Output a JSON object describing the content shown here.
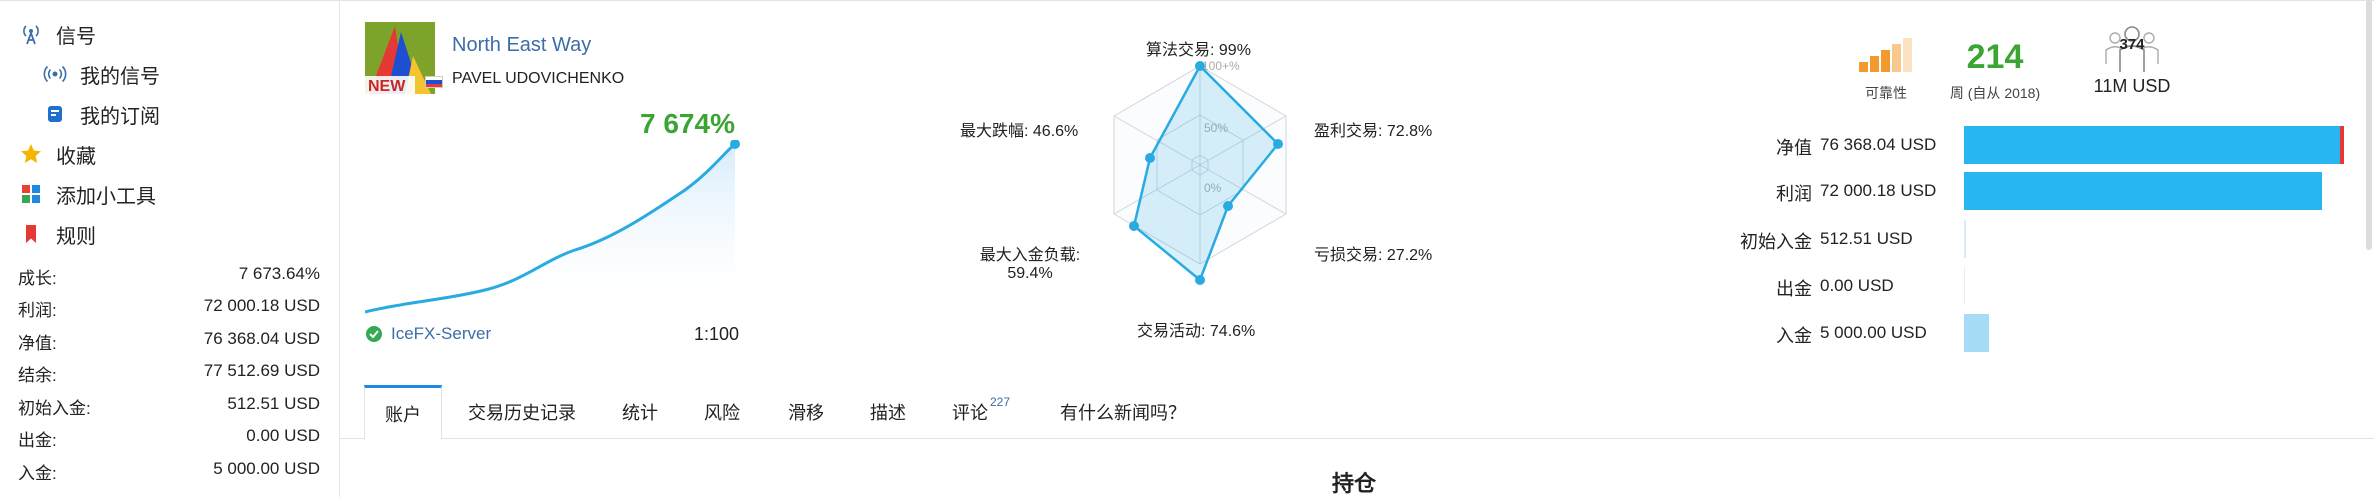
{
  "sidebar": {
    "nav": [
      {
        "label": "信号",
        "icon": "signal-tower-icon"
      },
      {
        "label": "我的信号",
        "icon": "broadcast-icon"
      },
      {
        "label": "我的订阅",
        "icon": "subscription-icon"
      },
      {
        "label": "收藏",
        "icon": "star-icon"
      },
      {
        "label": "添加小工具",
        "icon": "widgets-icon"
      },
      {
        "label": "规则",
        "icon": "bookmark-icon"
      }
    ],
    "stats": [
      {
        "label": "成长:",
        "value": "7 673.64%"
      },
      {
        "label": "利润:",
        "value": "72 000.18 USD"
      },
      {
        "label": "净值:",
        "value": "76 368.04 USD"
      },
      {
        "label": "结余:",
        "value": "77 512.69 USD"
      },
      {
        "label": "初始入金:",
        "value": "512.51 USD"
      },
      {
        "label": "出金:",
        "value": "0.00 USD"
      },
      {
        "label": "入金:",
        "value": "5 000.00 USD"
      }
    ]
  },
  "signal": {
    "name": "North East Way",
    "author": "PAVEL UDOVICHENKO",
    "logo_text": "NEW",
    "growth": "7 674%",
    "server": "IceFX-Server",
    "leverage": "1:100"
  },
  "radar": {
    "labels": [
      {
        "label": "算法交易: 99%"
      },
      {
        "label": "盈利交易: 72.8%"
      },
      {
        "label": "亏损交易: 27.2%"
      },
      {
        "label": "交易活动: 74.6%"
      },
      {
        "label": "最大入金负载:",
        "label2": "59.4%"
      },
      {
        "label": "最大跌幅: 46.6%"
      }
    ],
    "rings": [
      "100+%",
      "50%",
      "0%"
    ]
  },
  "badges": {
    "reliability_label": "可靠性",
    "weeks": "214",
    "weeks_label": "周 (自从 2018)",
    "subscribers": "374",
    "funds": "11M USD"
  },
  "bars": [
    {
      "label": "净值",
      "value": "76 368.04 USD",
      "fraction": 1.0,
      "color": "#29b6f0"
    },
    {
      "label": "利润",
      "value": "72 000.18 USD",
      "fraction": 0.943,
      "color": "#29b6f0"
    },
    {
      "label": "初始入金",
      "value": "512.51 USD",
      "fraction": 0.007,
      "color": "#29b6f0"
    },
    {
      "label": "出金",
      "value": "0.00 USD",
      "fraction": 0.0,
      "color": "#29b6f0"
    },
    {
      "label": "入金",
      "value": "5 000.00 USD",
      "fraction": 0.065,
      "color": "#a7dcf6"
    }
  ],
  "tabs": [
    {
      "label": "账户"
    },
    {
      "label": "交易历史记录"
    },
    {
      "label": "统计"
    },
    {
      "label": "风险"
    },
    {
      "label": "滑移"
    },
    {
      "label": "描述"
    },
    {
      "label": "评论",
      "badge": "227"
    },
    {
      "label": "有什么新闻吗？"
    }
  ],
  "section_title": "持仓",
  "colors": {
    "accent": "#1e88e5",
    "growth": "#3aa532",
    "link": "#3b6ea8",
    "chart": "#29abe2"
  }
}
